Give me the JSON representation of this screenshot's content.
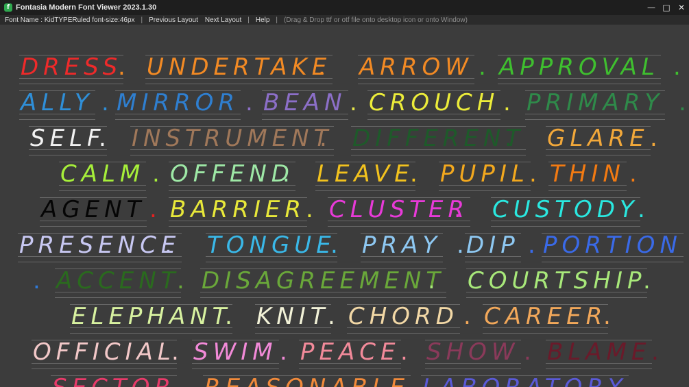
{
  "window": {
    "title": "Fontasia Modern Font Viewer 2023.1.30",
    "icon": "fontasia-app-icon",
    "controls": [
      "minimize-icon",
      "maximize-icon",
      "close-icon"
    ]
  },
  "menu": {
    "font_info": "Font Name : KidTYPERuled font-size:46px",
    "previous_layout": "Previous Layout",
    "next_layout": "Next Layout",
    "help": "Help",
    "hint": "(Drag & Drop ttf or otf file onto desktop icon or onto Window)"
  },
  "colors": {
    "background": "#3c3c3c",
    "titlebar": "#1e1e1e",
    "menubar": "#2b2b2b"
  },
  "rows": [
    {
      "items": [
        {
          "text": "DRESS",
          "color": "#ee2a2a"
        },
        {
          "text": ".",
          "color": "#f28a24"
        },
        {
          "text": "UNDERTAKE",
          "color": "#f28a24"
        },
        {
          "text": ".",
          "color": "#f28a24"
        },
        {
          "text": "ARROW",
          "color": "#f28a24"
        },
        {
          "text": ".",
          "color": "#3fbf2f"
        },
        {
          "text": "APPROVAL",
          "color": "#3fbf2f"
        },
        {
          "text": ".",
          "color": "#3fbf2f"
        }
      ]
    },
    {
      "items": [
        {
          "text": "ALLY",
          "color": "#2f8fd8"
        },
        {
          "text": ".",
          "color": "#2f8fd8"
        },
        {
          "text": "MIRROR",
          "color": "#2f7fd0"
        },
        {
          "text": ".",
          "color": "#8c6fc8"
        },
        {
          "text": "BEAN",
          "color": "#8c6fc8"
        },
        {
          "text": ".",
          "color": "#e8e84a"
        },
        {
          "text": "CROUCH",
          "color": "#ecec3a"
        },
        {
          "text": ".",
          "color": "#ecec3a"
        },
        {
          "text": "PRIMARY",
          "color": "#2f8a4a"
        },
        {
          "text": ".",
          "color": "#2f8a4a"
        }
      ]
    },
    {
      "items": [
        {
          "text": "SELF",
          "color": "#f2f2f2"
        },
        {
          "text": ".",
          "color": "#f2f2f2"
        },
        {
          "text": "INSTRUMENT",
          "color": "#a0785a"
        },
        {
          "text": ".",
          "color": "#a0785a"
        },
        {
          "text": "DIFFERENT",
          "color": "#1e5a2a"
        },
        {
          "text": ".",
          "color": "#1e5a2a"
        },
        {
          "text": "GLARE",
          "color": "#f2a83a"
        },
        {
          "text": ".",
          "color": "#f2a83a"
        }
      ]
    },
    {
      "items": [
        {
          "text": "CALM",
          "color": "#a6ee3a"
        },
        {
          "text": ".",
          "color": "#a6ee3a"
        },
        {
          "text": "OFFEND",
          "color": "#9ee8a6"
        },
        {
          "text": ".",
          "color": "#9ee8a6"
        },
        {
          "text": "LEAVE",
          "color": "#f2c21e"
        },
        {
          "text": ".",
          "color": "#f2c21e"
        },
        {
          "text": "PUPIL",
          "color": "#f2a81e"
        },
        {
          "text": ".",
          "color": "#f2a81e"
        },
        {
          "text": "THIN",
          "color": "#f27a12"
        },
        {
          "text": ".",
          "color": "#f27a12"
        }
      ]
    },
    {
      "items": [
        {
          "text": "AGENT",
          "color": "#050505"
        },
        {
          "text": ".",
          "color": "#e82020"
        },
        {
          "text": "BARRIER",
          "color": "#e8e83a"
        },
        {
          "text": ".",
          "color": "#e8e83a"
        },
        {
          "text": "CLUSTER",
          "color": "#e83ad8"
        },
        {
          "text": ".",
          "color": "#e83ad8"
        },
        {
          "text": "CUSTODY",
          "color": "#2ae8e0"
        },
        {
          "text": ".",
          "color": "#2ae8e0"
        }
      ]
    },
    {
      "items": [
        {
          "text": "PRESENCE",
          "color": "#c8c8f2"
        },
        {
          "text": ".",
          "color": "#c8c8f2"
        },
        {
          "text": "TONGUE",
          "color": "#3ab8e8"
        },
        {
          "text": ".",
          "color": "#3ab8e8"
        },
        {
          "text": "PRAY",
          "color": "#8ec8f2"
        },
        {
          "text": ".",
          "color": "#8ec8f2"
        },
        {
          "text": "DIP",
          "color": "#8ec8f2"
        },
        {
          "text": ".",
          "color": "#3a6ae8"
        },
        {
          "text": "PORTION",
          "color": "#3a6ae8"
        }
      ]
    },
    {
      "items": [
        {
          "text": ".",
          "color": "#2f7ad8"
        },
        {
          "text": "ACCENT",
          "color": "#2a6a1e"
        },
        {
          "text": ".",
          "color": "#6aa83a"
        },
        {
          "text": "DISAGREEMENT",
          "color": "#6aa83a"
        },
        {
          "text": ".",
          "color": "#a8e87a"
        },
        {
          "text": "COURTSHIP",
          "color": "#a8e87a"
        },
        {
          "text": ".",
          "color": "#a8e87a"
        }
      ]
    },
    {
      "items": [
        {
          "text": "ELEPHANT",
          "color": "#d8f2a0"
        },
        {
          "text": ".",
          "color": "#d8f2a0"
        },
        {
          "text": "KNIT",
          "color": "#f2f2d8"
        },
        {
          "text": ".",
          "color": "#f2f2d8"
        },
        {
          "text": "CHORD",
          "color": "#f2d8a6"
        },
        {
          "text": ".",
          "color": "#f2a85a"
        },
        {
          "text": "CAREER",
          "color": "#f2a85a"
        },
        {
          "text": ".",
          "color": "#f2a85a"
        }
      ]
    },
    {
      "items": [
        {
          "text": "OFFICIAL",
          "color": "#f2c8c8"
        },
        {
          "text": ".",
          "color": "#f2c8c8"
        },
        {
          "text": "SWIM",
          "color": "#f28ad8"
        },
        {
          "text": ".",
          "color": "#f28ad8"
        },
        {
          "text": "PEACE",
          "color": "#f28a9a"
        },
        {
          "text": ".",
          "color": "#f28a9a"
        },
        {
          "text": "SHOW",
          "color": "#8a3a5a"
        },
        {
          "text": ".",
          "color": "#8a3a5a"
        },
        {
          "text": "BLAME",
          "color": "#6a1a2a"
        },
        {
          "text": ".",
          "color": "#6a1a2a"
        }
      ]
    },
    {
      "items": [
        {
          "text": "SECTOR",
          "color": "#e83a6a"
        },
        {
          "text": ".",
          "color": "#e83a6a"
        },
        {
          "text": "REASONABLE",
          "color": "#f28a3a"
        },
        {
          "text": ".",
          "color": "#f28a3a"
        },
        {
          "text": "LABORATORY",
          "color": "#5a5ad8"
        }
      ]
    }
  ]
}
